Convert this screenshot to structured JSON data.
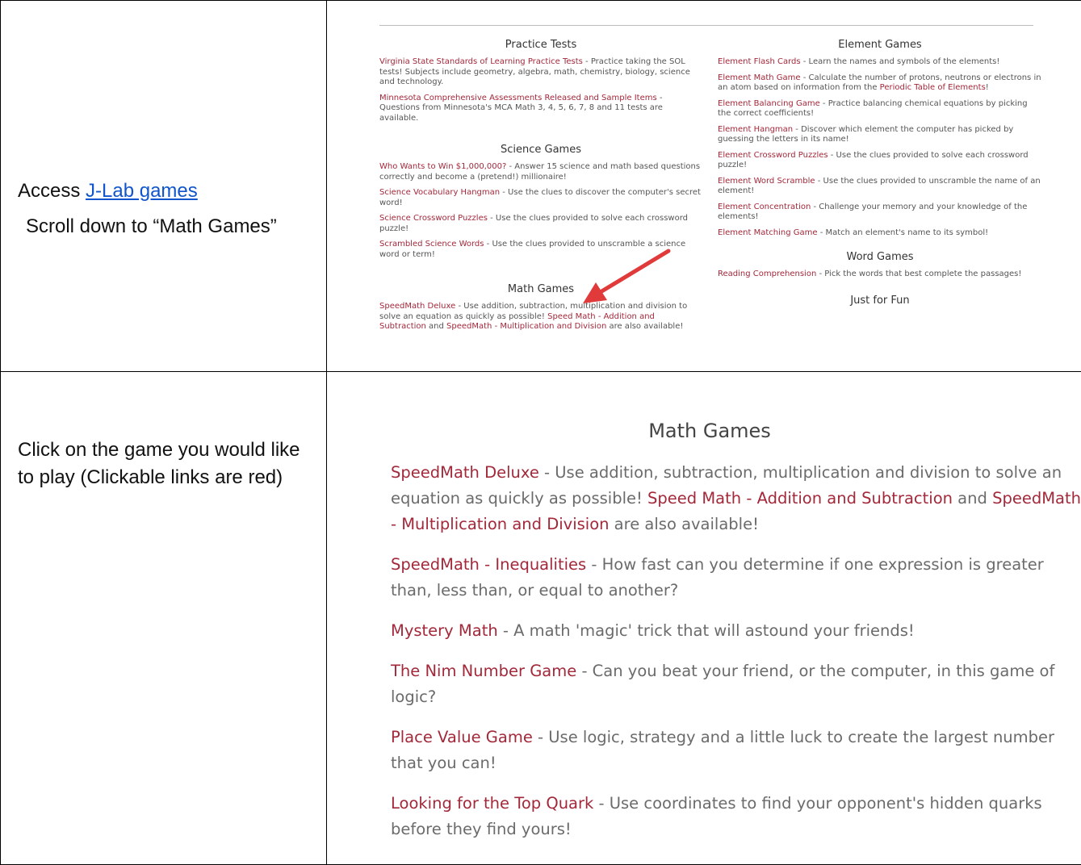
{
  "row1": {
    "access_prefix": "Access ",
    "access_link": "J-Lab games",
    "scroll_text": "Scroll down to “Math Games”"
  },
  "row2": {
    "instruction": "Click on the game you would like to play (Clickable links are red)"
  },
  "screenshot1": {
    "left_sections": [
      {
        "heading": "Practice Tests",
        "items": [
          {
            "link": "Virginia State Standards of Learning Practice Tests",
            "text": " - Practice taking the SOL tests! Subjects include geometry, algebra, math, chemistry, biology, science and technology."
          },
          {
            "link": "Minnesota Comprehensive Assessments Released and Sample Items",
            "text": " - Questions from Minnesota's MCA Math 3, 4, 5, 6, 7, 8 and 11 tests are available."
          }
        ]
      },
      {
        "heading": "Science Games",
        "items": [
          {
            "link": "Who Wants to Win $1,000,000?",
            "text": " - Answer 15 science and math based questions correctly and become a (pretend!) millionaire!"
          },
          {
            "link": "Science Vocabulary Hangman",
            "text": " - Use the clues to discover the computer's secret word!"
          },
          {
            "link": "Science Crossword Puzzles",
            "text": " - Use the clues provided to solve each crossword puzzle!"
          },
          {
            "link": "Scrambled Science Words",
            "text": " - Use the clues provided to unscramble a science word or term!"
          }
        ]
      },
      {
        "heading": "Math Games",
        "items": [
          {
            "link": "SpeedMath Deluxe",
            "text": " - Use addition, subtraction, multiplication and division to solve an equation as quickly as possible! ",
            "link2": "Speed Math - Addition and Subtraction",
            "text2": " and ",
            "link3": "SpeedMath - Multiplication and Division",
            "text3": " are also available!"
          }
        ]
      }
    ],
    "right_sections": [
      {
        "heading": "Element Games",
        "items": [
          {
            "link": "Element Flash Cards",
            "text": " - Learn the names and symbols of the elements!"
          },
          {
            "link": "Element Math Game",
            "text": " - Calculate the number of protons, neutrons or electrons in an atom based on information from the ",
            "link2": "Periodic Table of Elements",
            "text2": "!"
          },
          {
            "link": "Element Balancing Game",
            "text": " - Practice balancing chemical equations by picking the correct coefficients!"
          },
          {
            "link": "Element Hangman",
            "text": " - Discover which element the computer has picked by guessing the letters in its name!"
          },
          {
            "link": "Element Crossword Puzzles",
            "text": " - Use the clues provided to solve each crossword puzzle!"
          },
          {
            "link": "Element Word Scramble",
            "text": " - Use the clues provided to unscramble the name of an element!"
          },
          {
            "link": "Element Concentration",
            "text": " - Challenge your memory and your knowledge of the elements!"
          },
          {
            "link": "Element Matching Game",
            "text": " - Match an element's name to its symbol!"
          }
        ]
      },
      {
        "heading": "Word Games",
        "items": [
          {
            "link": "Reading Comprehension",
            "text": " - Pick the words that best complete the passages!"
          }
        ]
      },
      {
        "heading": "Just for Fun",
        "items": []
      }
    ],
    "arrow_color": "#e03a3a"
  },
  "screenshot2": {
    "heading": "Math Games",
    "items": [
      {
        "link": "SpeedMath Deluxe",
        "text": " - Use addition, subtraction, multiplication and division to solve an equation as quickly as possible! ",
        "link2": "Speed Math - Addition and Subtraction",
        "text2": " and ",
        "link3": "SpeedMath - Multiplication and Division",
        "text3": " are also available!"
      },
      {
        "link": "SpeedMath - Inequalities",
        "text": " - How fast can you determine if one expression is greater than, less than, or equal to another?"
      },
      {
        "link": "Mystery Math",
        "text": " - A math 'magic' trick that will astound your friends!"
      },
      {
        "link": "The Nim Number Game",
        "text": " - Can you beat your friend, or the computer, in this game of logic?"
      },
      {
        "link": "Place Value Game",
        "text": " - Use logic, strategy and a little luck to create the largest number that you can!"
      },
      {
        "link": "Looking for the Top Quark",
        "text": " - Use coordinates to find your opponent's hidden quarks before they find yours!"
      }
    ]
  },
  "colors": {
    "link_red": "#a3283a",
    "doc_link_blue": "#1155cc",
    "body_gray": "#555555"
  }
}
